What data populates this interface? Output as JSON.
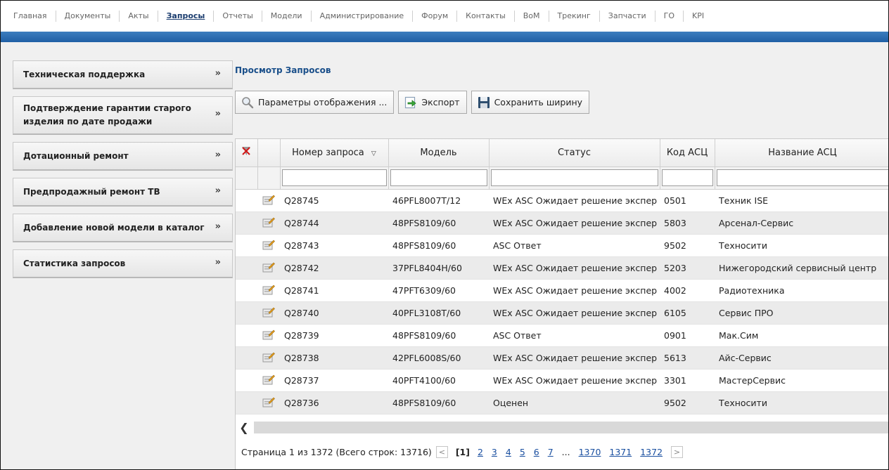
{
  "nav": {
    "items": [
      {
        "label": "Главная"
      },
      {
        "label": "Документы"
      },
      {
        "label": "Акты"
      },
      {
        "label": "Запросы",
        "active": true
      },
      {
        "label": "Отчеты"
      },
      {
        "label": "Модели"
      },
      {
        "label": "Администрирование"
      },
      {
        "label": "Форум"
      },
      {
        "label": "Контакты"
      },
      {
        "label": "BoM"
      },
      {
        "label": "Трекинг"
      },
      {
        "label": "Запчасти"
      },
      {
        "label": "ГО"
      },
      {
        "label": "KPI"
      }
    ]
  },
  "sidebar": {
    "items": [
      {
        "label": "Техническая поддержка",
        "icon": "double-chevron-down-icon"
      },
      {
        "label": "Подтверждение гарантии старого изделия по дате продажи",
        "icon": "double-chevron-down-icon"
      },
      {
        "label": "Дотационный ремонт",
        "icon": "double-chevron-down-icon"
      },
      {
        "label": "Предпродажный ремонт ТВ",
        "icon": "double-chevron-down-icon"
      },
      {
        "label": "Добавление новой модели в каталог",
        "icon": "double-chevron-down-icon"
      },
      {
        "label": "Статистика запросов",
        "icon": "double-chevron-down-icon"
      }
    ]
  },
  "main": {
    "title": "Просмотр Запросов",
    "toolbar": {
      "display_params": "Параметры отображения ...",
      "export": "Экспорт",
      "save_width": "Сохранить ширину"
    }
  },
  "grid": {
    "columns": [
      "",
      "",
      "Номер запроса",
      "Модель",
      "Статус",
      "Код АСЦ",
      "Название АСЦ"
    ],
    "sort_column": "Номер запроса",
    "rows": [
      {
        "id": "Q28745",
        "model": "46PFL8007T/12",
        "status": "WEx ASC Ожидает решение экспер",
        "code": "0501",
        "name": "Техник ISE"
      },
      {
        "id": "Q28744",
        "model": "48PFS8109/60",
        "status": "WEx ASC Ожидает решение экспер",
        "code": "5803",
        "name": "Арсенал-Сервис"
      },
      {
        "id": "Q28743",
        "model": "48PFS8109/60",
        "status": "ASC Ответ",
        "code": "9502",
        "name": "Техносити"
      },
      {
        "id": "Q28742",
        "model": "37PFL8404H/60",
        "status": "WEx ASC Ожидает решение экспер",
        "code": "5203",
        "name": "Нижегородский сервисный центр"
      },
      {
        "id": "Q28741",
        "model": "47PFT6309/60",
        "status": "WEx ASC Ожидает решение экспер",
        "code": "4002",
        "name": "Радиотехника"
      },
      {
        "id": "Q28740",
        "model": "40PFL3108T/60",
        "status": "WEx ASC Ожидает решение экспер",
        "code": "6105",
        "name": "Сервис ПРО"
      },
      {
        "id": "Q28739",
        "model": "48PFS8109/60",
        "status": "ASC Ответ",
        "code": "0901",
        "name": "Мак.Сим"
      },
      {
        "id": "Q28738",
        "model": "42PFL6008S/60",
        "status": "WEx ASC Ожидает решение экспер",
        "code": "5613",
        "name": "Айс-Сервис"
      },
      {
        "id": "Q28737",
        "model": "40PFT4100/60",
        "status": "WEx ASC Ожидает решение экспер",
        "code": "3301",
        "name": "МастерСервис"
      },
      {
        "id": "Q28736",
        "model": "48PFS8109/60",
        "status": "Оценен",
        "code": "9502",
        "name": "Техносити"
      }
    ]
  },
  "pager": {
    "summary": "Страница 1 из 1372 (Всего строк: 13716)",
    "prev": "<",
    "current": "[1]",
    "pages": [
      "2",
      "3",
      "4",
      "5",
      "6",
      "7"
    ],
    "dots": "...",
    "last_pages": [
      "1370",
      "1371",
      "1372"
    ],
    "next": ">"
  },
  "colors": {
    "accent_blue": "#1f5fa5",
    "title_blue": "#1a4f8a",
    "link_blue": "#1a4fa0"
  }
}
